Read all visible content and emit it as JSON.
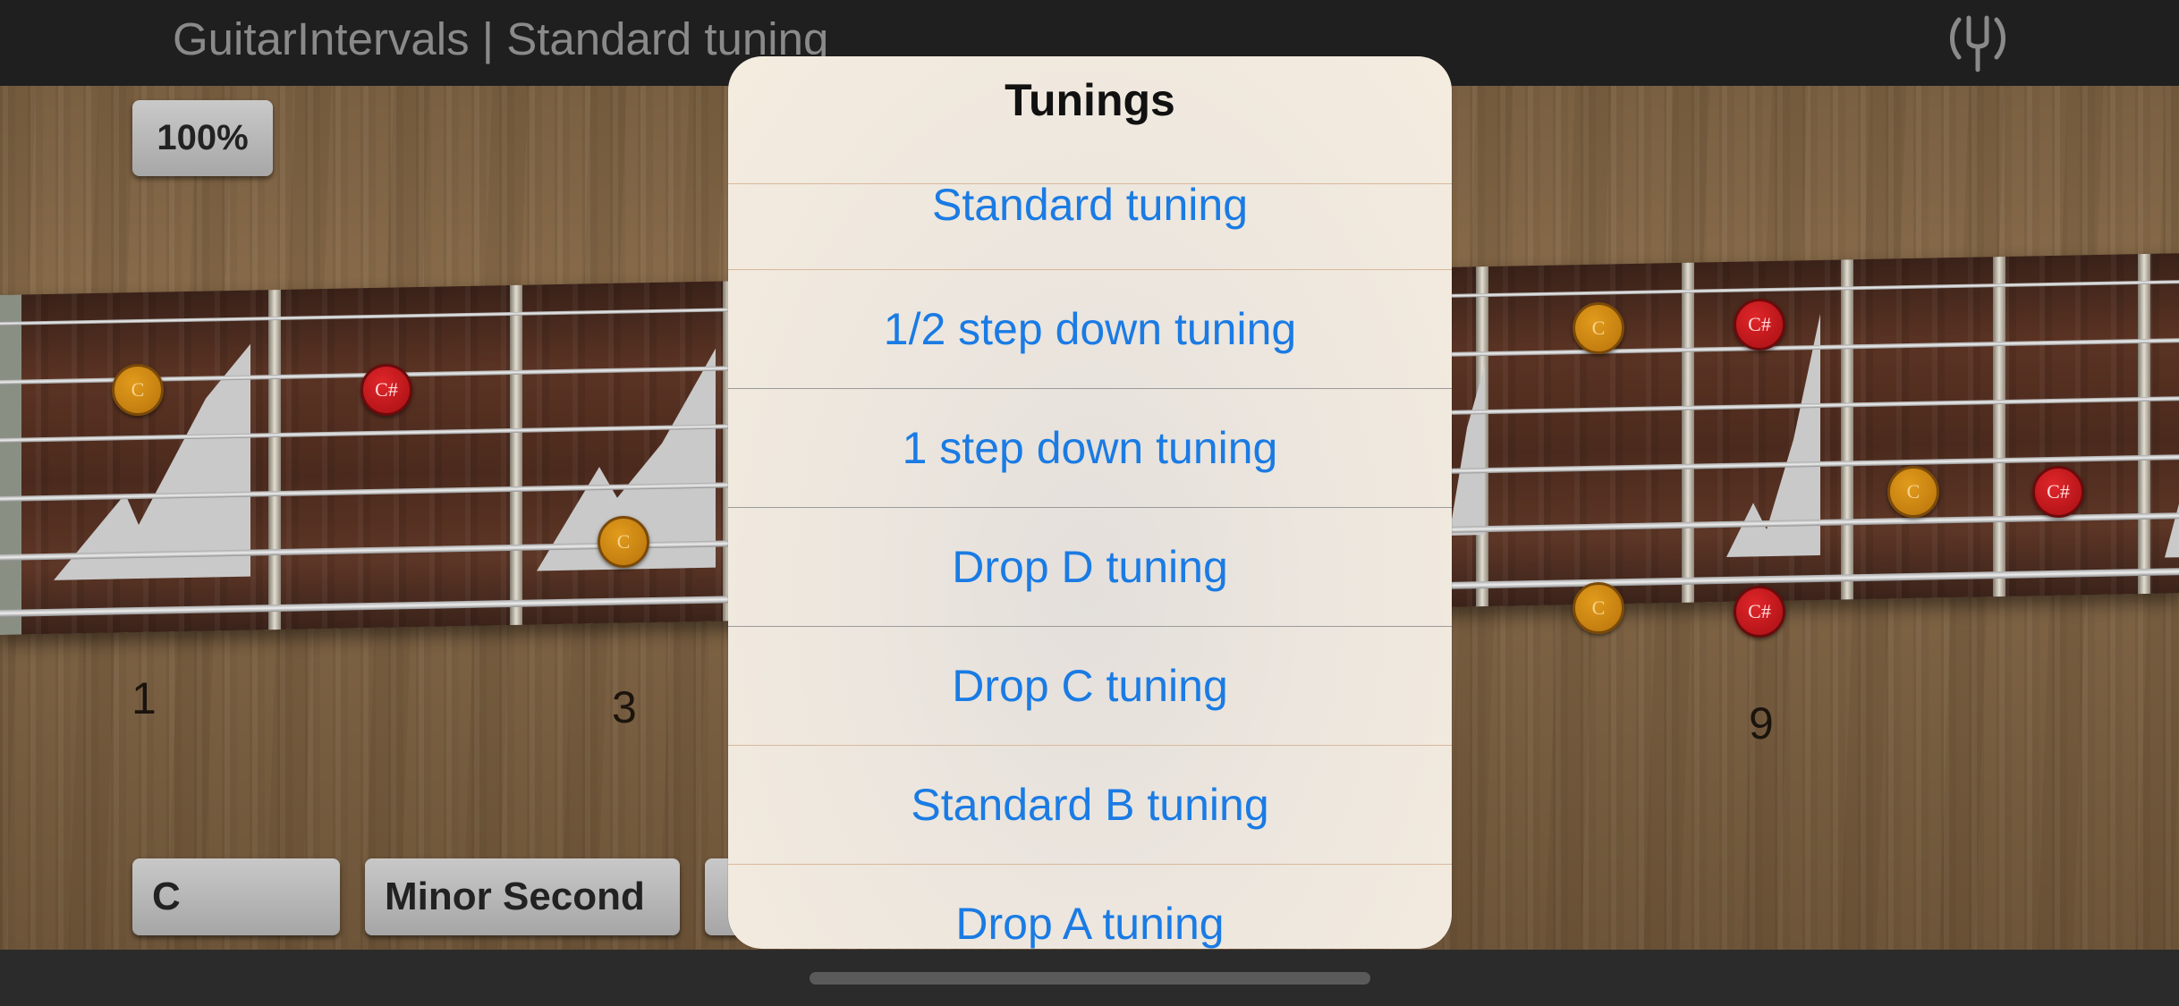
{
  "app": {
    "title": "GuitarIntervals | Standard tuning",
    "tuner_icon": "tuning-fork-icon"
  },
  "zoom": {
    "label": "100%"
  },
  "fretboard": {
    "fret_numbers": [
      "1",
      "3",
      "9"
    ],
    "notes": [
      {
        "label": "C",
        "kind": "c"
      },
      {
        "label": "C#",
        "kind": "cs"
      },
      {
        "label": "C",
        "kind": "c"
      },
      {
        "label": "C",
        "kind": "c"
      },
      {
        "label": "C#",
        "kind": "cs"
      },
      {
        "label": "C",
        "kind": "c"
      },
      {
        "label": "C#",
        "kind": "cs"
      },
      {
        "label": "C",
        "kind": "c"
      },
      {
        "label": "C#",
        "kind": "cs"
      }
    ]
  },
  "controls": {
    "root_note": "C",
    "interval": "Minor Second"
  },
  "dialog": {
    "title": "Tunings",
    "items": [
      "Standard tuning",
      "1/2 step down tuning",
      "1 step down tuning",
      "Drop D tuning",
      "Drop C tuning",
      "Standard B tuning",
      "Drop A tuning"
    ]
  },
  "colors": {
    "accent_link": "#1a7be4",
    "note_c": "#d98b12",
    "note_cs": "#cc1a1e"
  }
}
